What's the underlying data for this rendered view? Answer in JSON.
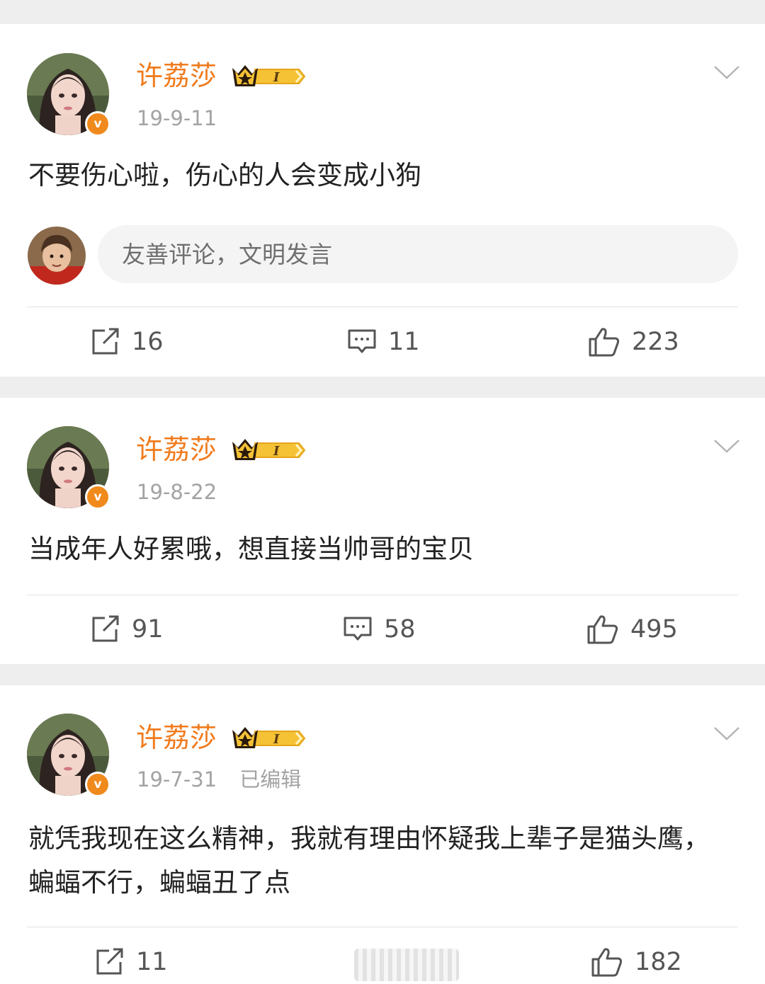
{
  "posts": [
    {
      "username": "许荔莎",
      "vip_level": "I",
      "verified_badge": "v",
      "date": "19-9-11",
      "edited": "",
      "text": "不要伤心啦，伤心的人会变成小狗",
      "comment_placeholder": "友善评论，文明发言",
      "reposts": "16",
      "comments": "11",
      "likes": "223"
    },
    {
      "username": "许荔莎",
      "vip_level": "I",
      "verified_badge": "v",
      "date": "19-8-22",
      "edited": "",
      "text": "当成年人好累哦，想直接当帅哥的宝贝",
      "reposts": "91",
      "comments": "58",
      "likes": "495"
    },
    {
      "username": "许荔莎",
      "vip_level": "I",
      "verified_badge": "v",
      "date": "19-7-31",
      "edited": "已编辑",
      "text": "就凭我现在这么精神，我就有理由怀疑我上辈子是猫头鹰，蝙蝠不行，蝙蝠丑了点",
      "reposts": "11",
      "comments": "",
      "likes": "182"
    }
  ],
  "icons": {
    "repost": "repost-icon",
    "comment": "comment-icon",
    "like": "thumbs-up-icon",
    "menu": "chevron-down-icon",
    "vip": "crown-vip-icon"
  },
  "colors": {
    "username": "#f07b1d",
    "verified": "#f08a1c",
    "vip_gold": "#f5c236",
    "meta_text": "#a3a3a3",
    "body_text": "#222222",
    "background": "#eeeeee",
    "card": "#ffffff"
  }
}
